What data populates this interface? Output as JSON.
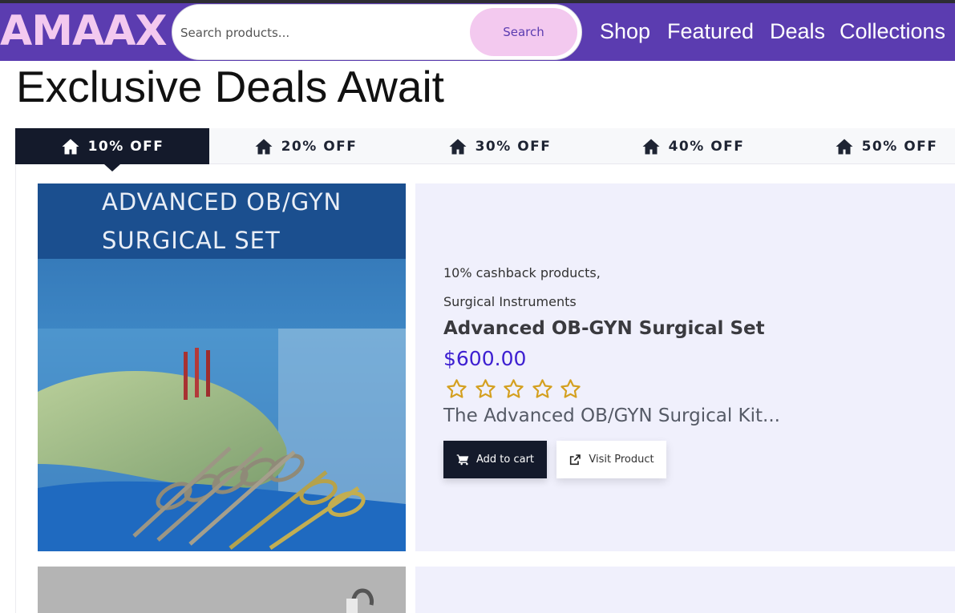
{
  "header": {
    "logo_text": "AMAAX",
    "search": {
      "placeholder": "Search products...",
      "button_label": "Search"
    },
    "nav": [
      {
        "label": "Shop"
      },
      {
        "label": "Featured"
      },
      {
        "label": "Deals"
      },
      {
        "label": "Collections"
      }
    ],
    "colors": {
      "bar": "#5b3cb0",
      "accent": "#f3c9ef"
    }
  },
  "page": {
    "title": "Exclusive Deals Await"
  },
  "tabs": [
    {
      "label": "10% OFF",
      "icon": "home-icon",
      "active": true
    },
    {
      "label": "20% OFF",
      "icon": "home-icon",
      "active": false
    },
    {
      "label": "30% OFF",
      "icon": "home-icon",
      "active": false
    },
    {
      "label": "40% OFF",
      "icon": "home-icon",
      "active": false
    },
    {
      "label": "50% OFF",
      "icon": "home-icon",
      "active": false
    }
  ],
  "product": {
    "image_text_line1": "ADVANCED OB/GYN",
    "image_text_line2": "SURGICAL SET",
    "category_1": "10% cashback products,",
    "category_2": "Surgical Instruments",
    "title": "Advanced OB-GYN Surgical Set",
    "price": "$600.00",
    "rating": 0,
    "rating_max": 5,
    "excerpt": "The Advanced OB/GYN Surgical Kit...",
    "add_to_cart_label": "Add to cart",
    "visit_label": "Visit Product",
    "colors": {
      "price": "#3d1fd1",
      "star": "#d4a020",
      "panel": "#f0f0fc",
      "dark": "#141a2b"
    }
  }
}
